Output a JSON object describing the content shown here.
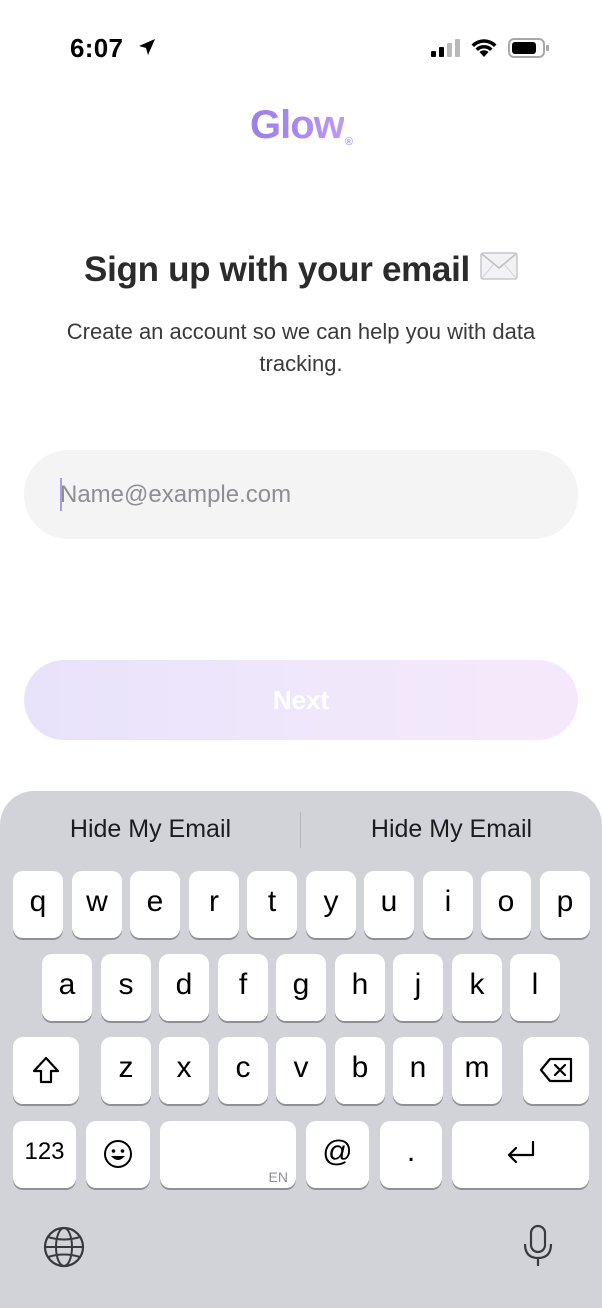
{
  "status_bar": {
    "time": "6:07"
  },
  "logo": {
    "text": "Glow",
    "reg": "®"
  },
  "title": "Sign up with your email",
  "subtitle": "Create an account so we can help you with data tracking.",
  "email": {
    "placeholder": "Name@example.com",
    "value": ""
  },
  "next_button": {
    "label": "Next"
  },
  "keyboard": {
    "suggestions": [
      "Hide My Email",
      "Hide My Email"
    ],
    "row1": [
      "q",
      "w",
      "e",
      "r",
      "t",
      "y",
      "u",
      "i",
      "o",
      "p"
    ],
    "row2": [
      "a",
      "s",
      "d",
      "f",
      "g",
      "h",
      "j",
      "k",
      "l"
    ],
    "row3": [
      "z",
      "x",
      "c",
      "v",
      "b",
      "n",
      "m"
    ],
    "numbers_label": "123",
    "space_sublabel": "EN",
    "at_label": "@",
    "period_label": "."
  }
}
